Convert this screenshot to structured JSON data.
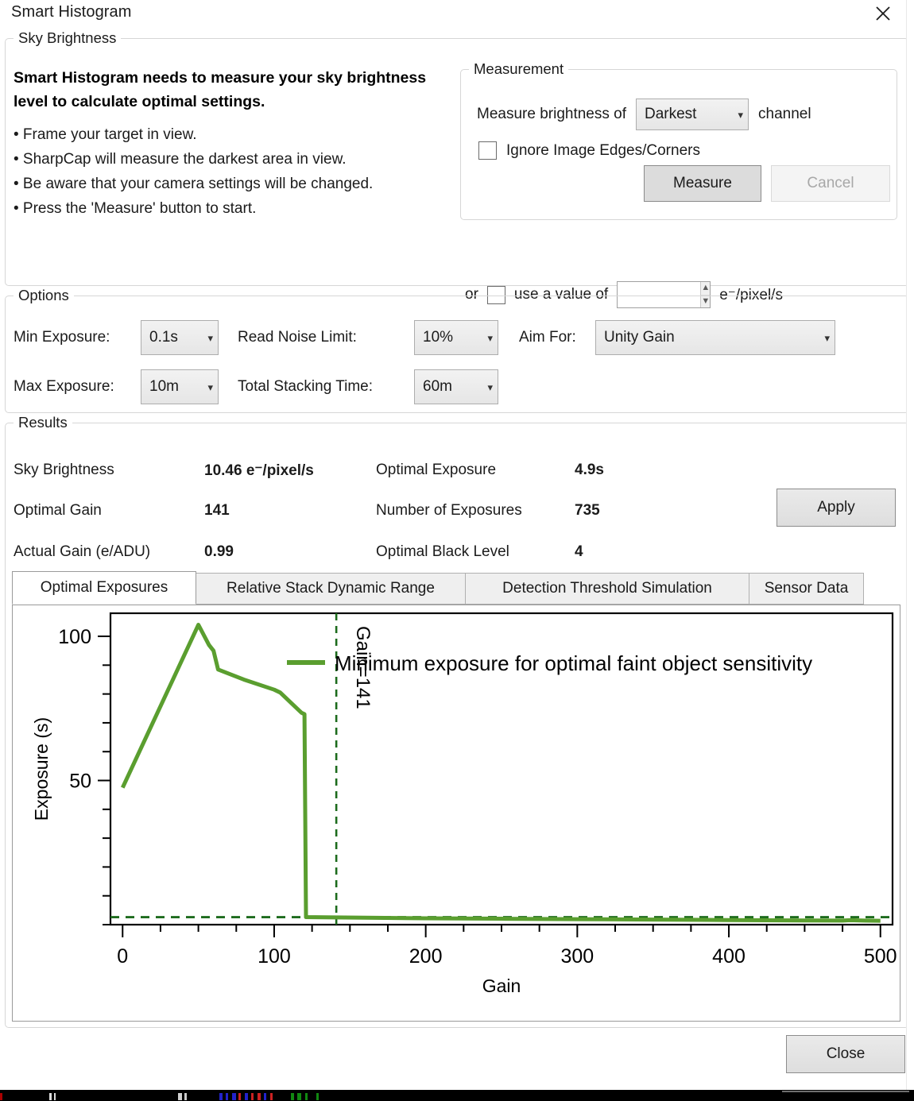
{
  "window": {
    "title": "Smart Histogram",
    "close_icon": "close-icon"
  },
  "sky_brightness": {
    "legend": "Sky Brightness",
    "headline": "Smart Histogram needs to measure your sky brightness level to calculate optimal settings.",
    "bullets": [
      "• Frame your target in view.",
      "• SharpCap will measure the darkest area in view.",
      "• Be aware that your camera settings will be changed.",
      "• Press the 'Measure' button to start."
    ],
    "measurement": {
      "legend": "Measurement",
      "measure_prefix": "Measure brightness of",
      "channel_value": "Darkest",
      "channel_suffix": "channel",
      "ignore_edges_label": "Ignore Image Edges/Corners",
      "ignore_edges_checked": false,
      "measure_button": "Measure",
      "cancel_button": "Cancel",
      "cancel_enabled": false
    },
    "manual_value": {
      "or_label": "or",
      "use_value_label": "use a value of",
      "use_value_checked": false,
      "value": "",
      "units": "e⁻/pixel/s"
    }
  },
  "options": {
    "legend": "Options",
    "min_exposure": {
      "label": "Min Exposure:",
      "value": "0.1s"
    },
    "read_noise_limit": {
      "label": "Read Noise Limit:",
      "value": "10%"
    },
    "aim_for": {
      "label": "Aim For:",
      "value": "Unity Gain"
    },
    "max_exposure": {
      "label": "Max Exposure:",
      "value": "10m"
    },
    "total_stacking_time": {
      "label": "Total Stacking Time:",
      "value": "60m"
    }
  },
  "results": {
    "legend": "Results",
    "rows": [
      {
        "label": "Sky Brightness",
        "value": "10.46 e⁻/pixel/s",
        "label2": "Optimal Exposure",
        "value2": "4.9s"
      },
      {
        "label": "Optimal Gain",
        "value": "141",
        "label2": "Number of Exposures",
        "value2": "735"
      },
      {
        "label": "Actual Gain (e/ADU)",
        "value": "0.99",
        "label2": "Optimal Black Level",
        "value2": "4"
      }
    ],
    "apply_button": "Apply",
    "tabs": [
      {
        "label": "Optimal Exposures",
        "active": true
      },
      {
        "label": "Relative Stack Dynamic Range",
        "active": false
      },
      {
        "label": "Detection Threshold Simulation",
        "active": false
      },
      {
        "label": "Sensor Data",
        "active": false
      }
    ]
  },
  "footer": {
    "close_button": "Close"
  },
  "chart_data": {
    "type": "line",
    "title": "",
    "xlabel": "Gain",
    "ylabel": "Exposure (s)",
    "xlim": [
      -8,
      508
    ],
    "ylim": [
      0,
      108
    ],
    "xticks": [
      0,
      100,
      200,
      300,
      400,
      500
    ],
    "xminor_step": 25,
    "yticks": [
      50,
      100
    ],
    "yminor_step": 10,
    "grid": false,
    "legend_position": "top-right-inside",
    "series": [
      {
        "name": "Minimum exposure for optimal faint object sensitivity",
        "color": "#5a9e2f",
        "style": "solid",
        "x": [
          0,
          50,
          57,
          60,
          63,
          80,
          100,
          104,
          118,
          120,
          121,
          140,
          160,
          200,
          250,
          300,
          350,
          400,
          450,
          475,
          480,
          490,
          500
        ],
        "y": [
          47.5,
          104,
          97,
          95,
          88.5,
          85,
          81.5,
          80.5,
          73.5,
          73,
          2.6,
          2.5,
          2.4,
          2.2,
          2.05,
          1.9,
          1.75,
          1.6,
          1.45,
          1.4,
          1.55,
          1.4,
          1.35
        ]
      }
    ],
    "reference_lines": [
      {
        "name": "Gain=141",
        "orientation": "vertical",
        "value": 141,
        "label": "Gain=141",
        "color": "#1d6b1d",
        "style": "dashed"
      },
      {
        "name": "minimum-exposure-floor",
        "orientation": "horizontal",
        "value": 2.6,
        "label": "",
        "color": "#1d6b1d",
        "style": "dashed"
      }
    ]
  }
}
